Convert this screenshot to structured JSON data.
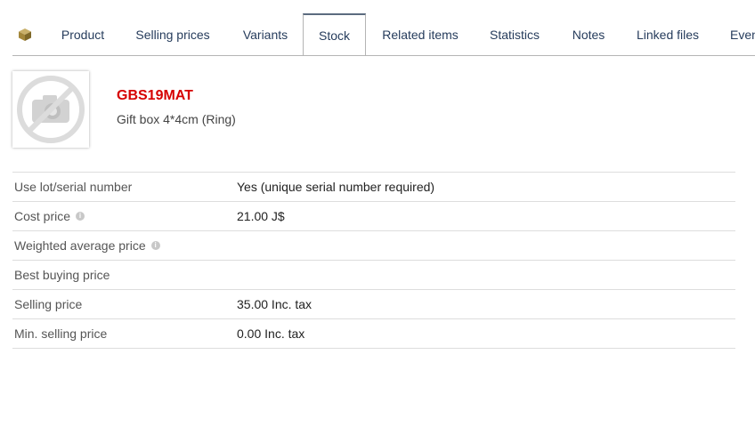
{
  "tabs": [
    {
      "label": "Product",
      "active": false
    },
    {
      "label": "Selling prices",
      "active": false
    },
    {
      "label": "Variants",
      "active": false
    },
    {
      "label": "Stock",
      "active": true
    },
    {
      "label": "Related items",
      "active": false
    },
    {
      "label": "Statistics",
      "active": false
    },
    {
      "label": "Notes",
      "active": false
    },
    {
      "label": "Linked files",
      "active": false
    },
    {
      "label": "Even",
      "active": false
    }
  ],
  "product": {
    "ref": "GBS19MAT",
    "label": "Gift box 4*4cm (Ring)",
    "photo_icon": "no-photo-camera-icon"
  },
  "fields": [
    {
      "key": "Use lot/serial number",
      "value": "Yes (unique serial number required)",
      "info": false
    },
    {
      "key": "Cost price",
      "value": "21.00 J$",
      "info": true
    },
    {
      "key": "Weighted average price",
      "value": "",
      "info": true
    },
    {
      "key": "Best buying price",
      "value": "",
      "info": false
    },
    {
      "key": "Selling price",
      "value": "35.00 Inc. tax",
      "info": false
    },
    {
      "key": "Min. selling price",
      "value": "0.00 Inc. tax",
      "info": false
    }
  ],
  "colors": {
    "ref": "#d60000",
    "tab_text": "#263c5c",
    "module_icon": "#a3873a"
  }
}
